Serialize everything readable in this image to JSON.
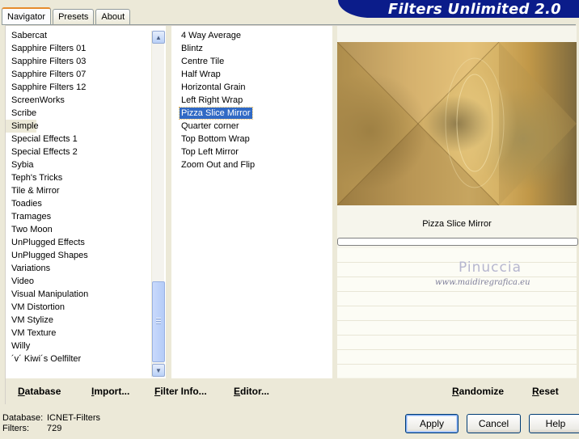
{
  "tabs": [
    {
      "label": "Navigator",
      "active": true
    },
    {
      "label": "Presets",
      "active": false
    },
    {
      "label": "About",
      "active": false
    }
  ],
  "brand": "Filters Unlimited 2.0",
  "categories": [
    "Sabercat",
    "Sapphire Filters 01",
    "Sapphire Filters 03",
    "Sapphire Filters 07",
    "Sapphire Filters 12",
    "ScreenWorks",
    "Scribe",
    "Simple",
    "Special Effects 1",
    "Special Effects 2",
    "Sybia",
    "Teph's Tricks",
    "Tile & Mirror",
    "Toadies",
    "Tramages",
    "Two Moon",
    "UnPlugged Effects",
    "UnPlugged Shapes",
    "Variations",
    "Video",
    "Visual Manipulation",
    "VM Distortion",
    "VM Stylize",
    "VM Texture",
    "Willy",
    "´v´ Kiwi´s Oelfilter"
  ],
  "current_category": "Simple",
  "filters": [
    "4 Way Average",
    "Blintz",
    "Centre Tile",
    "Half Wrap",
    "Horizontal Grain",
    "Left Right Wrap",
    "Pizza Slice Mirror",
    "Quarter corner",
    "Top Bottom Wrap",
    "Top Left Mirror",
    "Zoom Out and Flip"
  ],
  "selected_filter": "Pizza Slice Mirror",
  "preview": {
    "title": "Pizza Slice Mirror",
    "watermark_name": "Pinuccia",
    "watermark_url": "www.maidiregrafica.eu"
  },
  "actions": {
    "database": "Database",
    "import": "Import...",
    "filter_info": "Filter Info...",
    "editor": "Editor...",
    "randomize": "Randomize",
    "reset": "Reset"
  },
  "status": {
    "database_label": "Database:",
    "database_value": "ICNET-Filters",
    "filters_label": "Filters:",
    "filters_value": "729"
  },
  "buttons": {
    "apply": "Apply",
    "cancel": "Cancel",
    "help": "Help"
  },
  "colors": {
    "brand_bg": "#0b1c8a",
    "selection": "#316ac5",
    "dialog_bg": "#ece9d8"
  },
  "icons": {
    "scroll_up": "chevron-up-icon",
    "scroll_down": "chevron-down-icon"
  }
}
